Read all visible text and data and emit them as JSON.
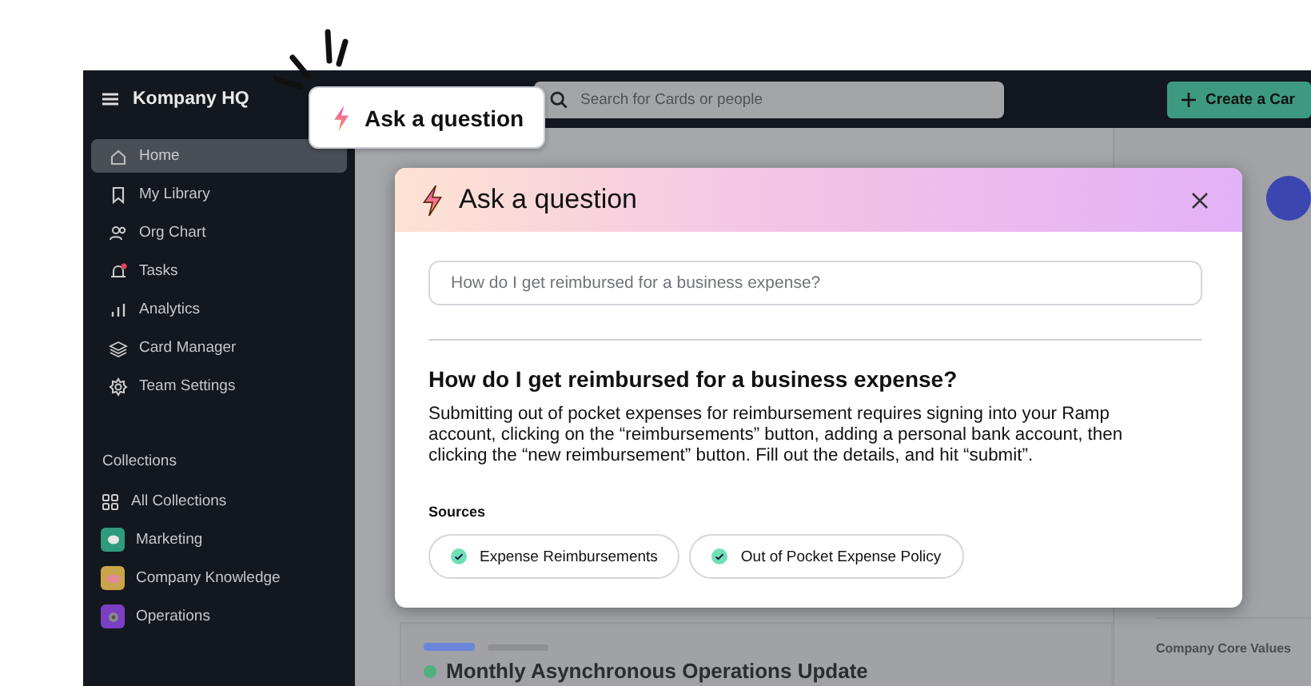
{
  "app": {
    "title": "Kompany HQ"
  },
  "search": {
    "placeholder": "Search for Cards or people"
  },
  "create_button": {
    "label": "Create a Car"
  },
  "sidebar": {
    "items": [
      {
        "label": "Home",
        "selected": true
      },
      {
        "label": "My Library",
        "selected": false
      },
      {
        "label": "Org Chart",
        "selected": false
      },
      {
        "label": "Tasks",
        "selected": false
      },
      {
        "label": "Analytics",
        "selected": false
      },
      {
        "label": "Card Manager",
        "selected": false
      },
      {
        "label": "Team Settings",
        "selected": false
      }
    ],
    "collections_heading": "Collections",
    "collections": [
      {
        "label": "All Collections"
      },
      {
        "label": "Marketing",
        "color": "#2f9a7c"
      },
      {
        "label": "Company Knowledge",
        "color": "#c9a44a"
      },
      {
        "label": "Operations",
        "color": "#7b3fc4"
      }
    ]
  },
  "background": {
    "feed_title": "Monthly Asynchronous Operations Update",
    "side_card": "Company Core Values"
  },
  "callout": {
    "label": "Ask a question"
  },
  "modal": {
    "title": "Ask a question",
    "question_value": "How do I get reimbursed for a business expense?",
    "answer_heading": "How do I get reimbursed for a business expense?",
    "answer": "Submitting out of pocket expenses for reimbursement requires signing into your Ramp account, clicking on the “reimbursements” button, adding a personal bank account, then clicking the “new reimbursement” button. Fill out the details, and hit “submit”.",
    "sources_label": "Sources",
    "sources": [
      {
        "label": "Expense Reimbursements",
        "verified": true
      },
      {
        "label": "Out of Pocket Expense Policy",
        "verified": true
      }
    ]
  }
}
